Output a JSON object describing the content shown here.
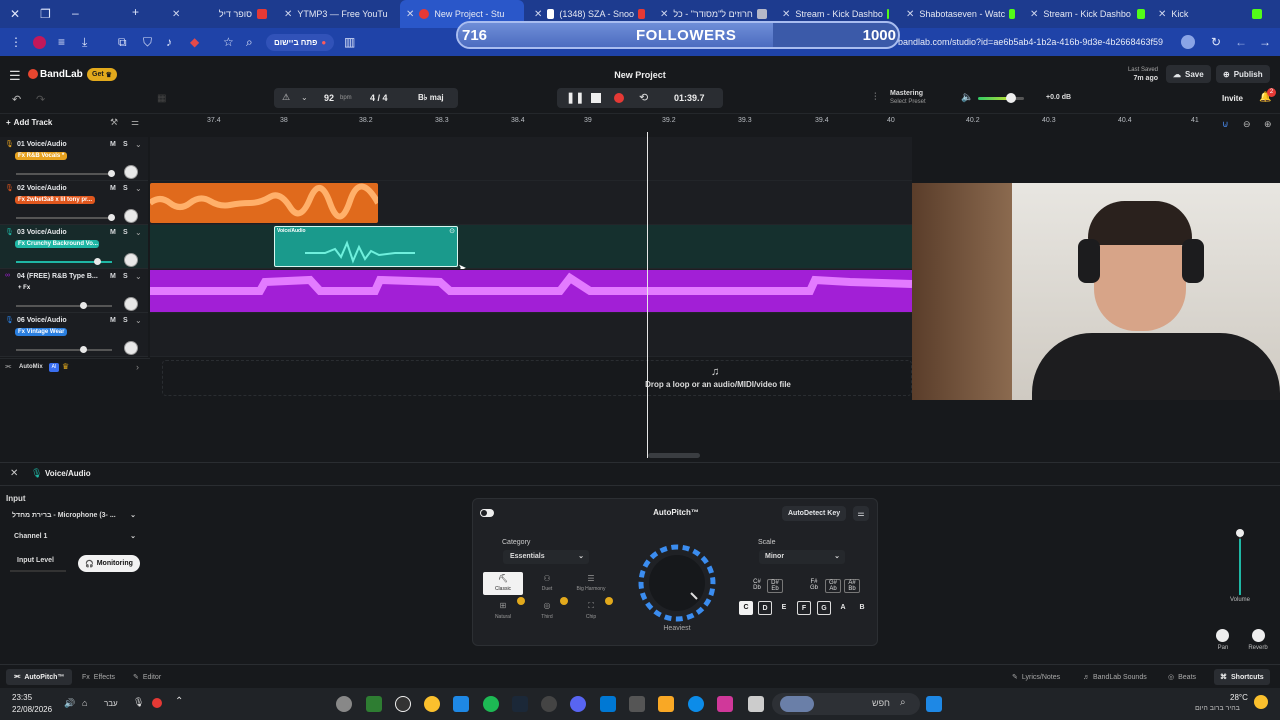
{
  "browser": {
    "tabs": [
      {
        "title": "סופר דיל"
      },
      {
        "title": "YTMP3 — Free YouTu"
      },
      {
        "title": "New Project - Stu"
      },
      {
        "title": "(1348) SZA - Snoo"
      },
      {
        "title": "חרוזים ל\"מסודר\" - כל"
      },
      {
        "title": "Stream - Kick Dashbo"
      },
      {
        "title": "Shabotaseven - Watc"
      },
      {
        "title": "Stream - Kick Dashbo"
      },
      {
        "title": "Kick"
      }
    ],
    "url": "bandlab.com/studio?id=ae6b5ab4-1b2a-416b-9d3e-4b2668463f59",
    "pill_label": "פתח ביישום"
  },
  "overlay": {
    "followers_current": "716",
    "followers_label": "FOLLOWERS",
    "followers_goal": "1000",
    "progress": 0.716
  },
  "app": {
    "brand": "BandLab",
    "get_label": "Get",
    "project_title": "New Project",
    "last_saved_label": "Last Saved",
    "last_saved_value": "7m ago",
    "save_label": "Save",
    "publish_label": "Publish",
    "invite_label": "Invite",
    "notif_count": "2",
    "bpm": "92",
    "bpm_unit": "bpm",
    "time_sig": "4 / 4",
    "key": "B♭ maj",
    "time": "01:39.7",
    "mastering_label": "Mastering",
    "mastering_sub": "Select Preset",
    "master_db": "+0.0 dB",
    "add_track_label": "Add Track"
  },
  "ruler": [
    "37.4",
    "38",
    "38.2",
    "38.3",
    "38.4",
    "39",
    "39.2",
    "39.3",
    "39.4",
    "40",
    "40.2",
    "40.3",
    "40.4",
    "41"
  ],
  "tracks": [
    {
      "name": "01  Voice/Audio",
      "fx": "Fx R&B Vocals *",
      "fx_color": "#e7a21f"
    },
    {
      "name": "02  Voice/Audio",
      "fx": "Fx 2wbet3a8 x lil tony pr...",
      "fx_color": "#e0571e"
    },
    {
      "name": "03  Voice/Audio",
      "fx": "Fx Crunchy Backround Vo...",
      "fx_color": "#1fb7a5"
    },
    {
      "name": "04  (FREE) R&B Type B...",
      "fx": "+ Fx",
      "fx_color": "transparent"
    },
    {
      "name": "06  Voice/Audio",
      "fx": "Fx Vintage Wear",
      "fx_color": "#2a7fe0"
    }
  ],
  "automix_label": "AutoMix",
  "region_label": "Voice/Audio",
  "drop_hint": "Drop a loop or an audio/MIDI/video file",
  "panel": {
    "track_label": "Voice/Audio",
    "input_label": "Input",
    "input_device": "ברירת מחדל - Microphone (3- ...",
    "channel": "Channel 1",
    "input_level_label": "Input Level",
    "monitoring_label": "Monitoring",
    "volume_label": "Volume",
    "pan_label": "Pan",
    "reverb_label": "Reverb"
  },
  "autopitch": {
    "title": "AutoPitch™",
    "autodetect_label": "AutoDetect Key",
    "category_label": "Category",
    "category_value": "Essentials",
    "scale_label": "Scale",
    "scale_value": "Minor",
    "knob_label": "Heaviest",
    "presets": [
      "Classic",
      "Duet",
      "Big Harmony",
      "Natural",
      "Third",
      "Chip"
    ],
    "sharps": [
      "C#",
      "D#",
      "F#",
      "G#",
      "A#"
    ],
    "flats": [
      "Db",
      "Eb",
      "Gb",
      "Ab",
      "Bb"
    ],
    "keys": [
      "C",
      "D",
      "E",
      "F",
      "G",
      "A",
      "B"
    ]
  },
  "footer": {
    "tabs": [
      "AutoPitch™",
      "Effects",
      "Editor"
    ],
    "right": [
      "Lyrics/Notes",
      "BandLab Sounds",
      "Beats",
      "Shortcuts"
    ]
  },
  "taskbar": {
    "time": "23:35",
    "date": "22/08/2026",
    "lang": "עבר",
    "search": "חפש",
    "weather_temp": "28°C",
    "weather_desc": "בהיר ברוב היום"
  },
  "colors": {
    "orange_region": "#e06a1c",
    "teal_region": "#1a9a8c",
    "purple_region": "#a21fd6",
    "browser_blue": "#1f43a8"
  }
}
